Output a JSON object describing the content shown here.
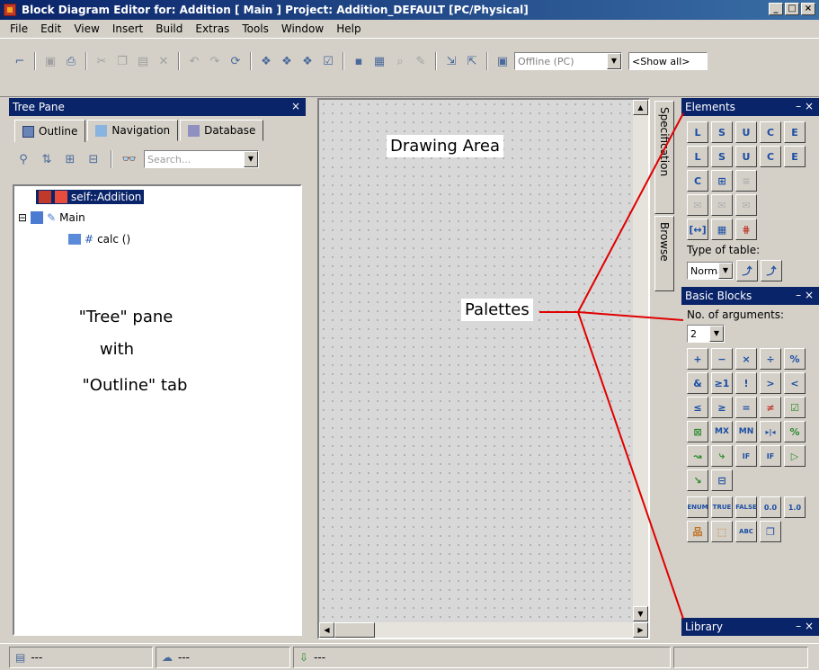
{
  "window": {
    "title": "Block Diagram Editor for: Addition [ Main ] Project: Addition_DEFAULT [PC/Physical]",
    "min": "_",
    "max": "□",
    "close": "×"
  },
  "menu": [
    "File",
    "Edit",
    "View",
    "Insert",
    "Build",
    "Extras",
    "Tools",
    "Window",
    "Help"
  ],
  "toolbar": {
    "target_combo": "Offline (PC)",
    "filter_combo": "<Show all>"
  },
  "tree_pane": {
    "title": "Tree Pane",
    "close": "×",
    "tabs": [
      "Outline",
      "Navigation",
      "Database"
    ],
    "search_placeholder": "Search...",
    "nodes": [
      "self::Addition",
      "Main",
      "calc ()"
    ],
    "expand_symbol": "⊟"
  },
  "side_tabs": [
    "Specification",
    "Browse"
  ],
  "elements_palette": {
    "title": "Elements",
    "controls": "– ×",
    "row1": [
      "L",
      "S",
      "U",
      "C",
      "E"
    ],
    "row2": [
      "L",
      "S",
      "U",
      "C",
      "E"
    ],
    "row3": [
      "C",
      "⊞",
      "≡"
    ],
    "row4": [
      "✉",
      "✉",
      "✉"
    ],
    "row5": [
      "[↔]",
      "▦",
      "⋕"
    ],
    "type_label": "Type of table:",
    "type_value": "Normal"
  },
  "basic_blocks": {
    "title": "Basic Blocks",
    "controls": "– ×",
    "args_label": "No. of arguments:",
    "args_value": "2",
    "row1": [
      "+",
      "−",
      "×",
      "÷",
      "%"
    ],
    "row2": [
      "&",
      "≥1",
      "!",
      ">",
      "<"
    ],
    "row3": [
      "≤",
      "≥",
      "=",
      "≠",
      "☑"
    ],
    "row4": [
      "⊠",
      "MX",
      "MN",
      "▸|◂",
      "%"
    ],
    "row5": [
      "↝",
      "⤷",
      "IF",
      "IF",
      "▷"
    ],
    "row6": [
      "↘",
      "⊟"
    ],
    "row7": [
      "ENUM",
      "TRUE",
      "FALSE",
      "0.0",
      "1.0"
    ],
    "row8": [
      "品",
      "⬚",
      "ABC",
      "❐"
    ]
  },
  "library": {
    "title": "Library",
    "controls": "– ×"
  },
  "status": [
    "---",
    "---",
    "---"
  ],
  "annotations": {
    "drawing_area": "Drawing Area",
    "palettes": "Palettes",
    "tree_line1": "\"Tree\" pane",
    "tree_line2": "with",
    "tree_line3": "\"Outline\" tab",
    "line_color": "#e00000"
  }
}
